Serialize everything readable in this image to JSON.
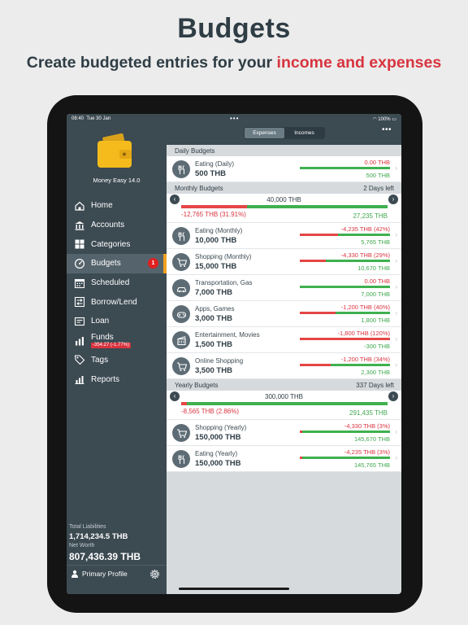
{
  "hero": {
    "title": "Budgets",
    "subtitle_prefix": "Create budgeted entries for your ",
    "subtitle_accent": "income and expenses"
  },
  "status": {
    "time": "08:40",
    "date": "Tue 30 Jan",
    "battery": "100%",
    "dots": "•••"
  },
  "app": {
    "name": "Money Easy 14.0"
  },
  "sidebar": {
    "items": [
      {
        "label": "Home",
        "icon": "home-icon"
      },
      {
        "label": "Accounts",
        "icon": "bank-icon"
      },
      {
        "label": "Categories",
        "icon": "grid-icon"
      },
      {
        "label": "Budgets",
        "icon": "budget-gauge-icon",
        "active": true,
        "badge": "1"
      },
      {
        "label": "Scheduled",
        "icon": "calendar-icon"
      },
      {
        "label": "Borrow/Lend",
        "icon": "exchange-icon"
      },
      {
        "label": "Loan",
        "icon": "loan-icon"
      },
      {
        "label": "Funds",
        "icon": "funds-icon",
        "sub": "-354.27 (-1.77%)"
      },
      {
        "label": "Tags",
        "icon": "tag-icon"
      },
      {
        "label": "Reports",
        "icon": "chart-icon"
      }
    ],
    "total_liabilities_label": "Total Liabilities",
    "total_liabilities_value": "1,714,234.5 THB",
    "net_worth_label": "Net Worth",
    "net_worth_value": "807,436.39 THB",
    "profile": "Primary Profile"
  },
  "topbar": {
    "tabs": [
      "Expenses",
      "Incomes"
    ],
    "active_tab": 0,
    "more": "•••"
  },
  "daily": {
    "title": "Daily Budgets",
    "items": [
      {
        "name": "Eating (Daily)",
        "amount": "500 THB",
        "spent": "0.00 THB",
        "left": "500 THB",
        "ratio": 0,
        "icon": "cutlery-icon"
      }
    ]
  },
  "monthly": {
    "title": "Monthly Budgets",
    "right": "2 Days left",
    "total": "40,000 THB",
    "spent": "-12,765 THB (31.91%)",
    "left": "27,235 THB",
    "ratio": 0.3191,
    "items": [
      {
        "name": "Eating (Monthly)",
        "amount": "10,000 THB",
        "spent": "-4,235 THB (42%)",
        "left": "5,765 THB",
        "ratio": 0.42,
        "icon": "cutlery-icon"
      },
      {
        "name": "Shopping (Monthly)",
        "amount": "15,000 THB",
        "spent": "-4,330 THB (29%)",
        "left": "10,670 THB",
        "ratio": 0.29,
        "icon": "cart-icon"
      },
      {
        "name": "Transportation, Gas",
        "amount": "7,000 THB",
        "spent": "0.00 THB",
        "left": "7,000 THB",
        "ratio": 0,
        "icon": "car-icon"
      },
      {
        "name": "Apps, Games",
        "amount": "3,000 THB",
        "spent": "-1,200 THB (40%)",
        "left": "1,800 THB",
        "ratio": 0.4,
        "icon": "gamepad-icon"
      },
      {
        "name": "Entertainment, Movies",
        "amount": "1,500 THB",
        "spent": "-1,800 THB (120%)",
        "left": "-300 THB",
        "ratio": 1.0,
        "icon": "film-icon"
      },
      {
        "name": "Online Shopping",
        "amount": "3,500 THB",
        "spent": "-1,200 THB (34%)",
        "left": "2,300 THB",
        "ratio": 0.34,
        "icon": "cart-icon"
      }
    ]
  },
  "yearly": {
    "title": "Yearly Budgets",
    "right": "337 Days left",
    "total": "300,000 THB",
    "spent": "-8,565 THB (2.86%)",
    "left": "291,435 THB",
    "ratio": 0.0286,
    "items": [
      {
        "name": "Shopping (Yearly)",
        "amount": "150,000 THB",
        "spent": "-4,330 THB (3%)",
        "left": "145,670 THB",
        "ratio": 0.03,
        "icon": "cart-icon"
      },
      {
        "name": "Eating (Yearly)",
        "amount": "150,000 THB",
        "spent": "-4,235 THB (3%)",
        "left": "145,765 THB",
        "ratio": 0.03,
        "icon": "cutlery-icon"
      }
    ]
  },
  "colors": {
    "sidebar": "#3c4a52",
    "accent_red": "#d8343f",
    "accent_green": "#3fb04f",
    "active_marker": "#f0a020"
  }
}
